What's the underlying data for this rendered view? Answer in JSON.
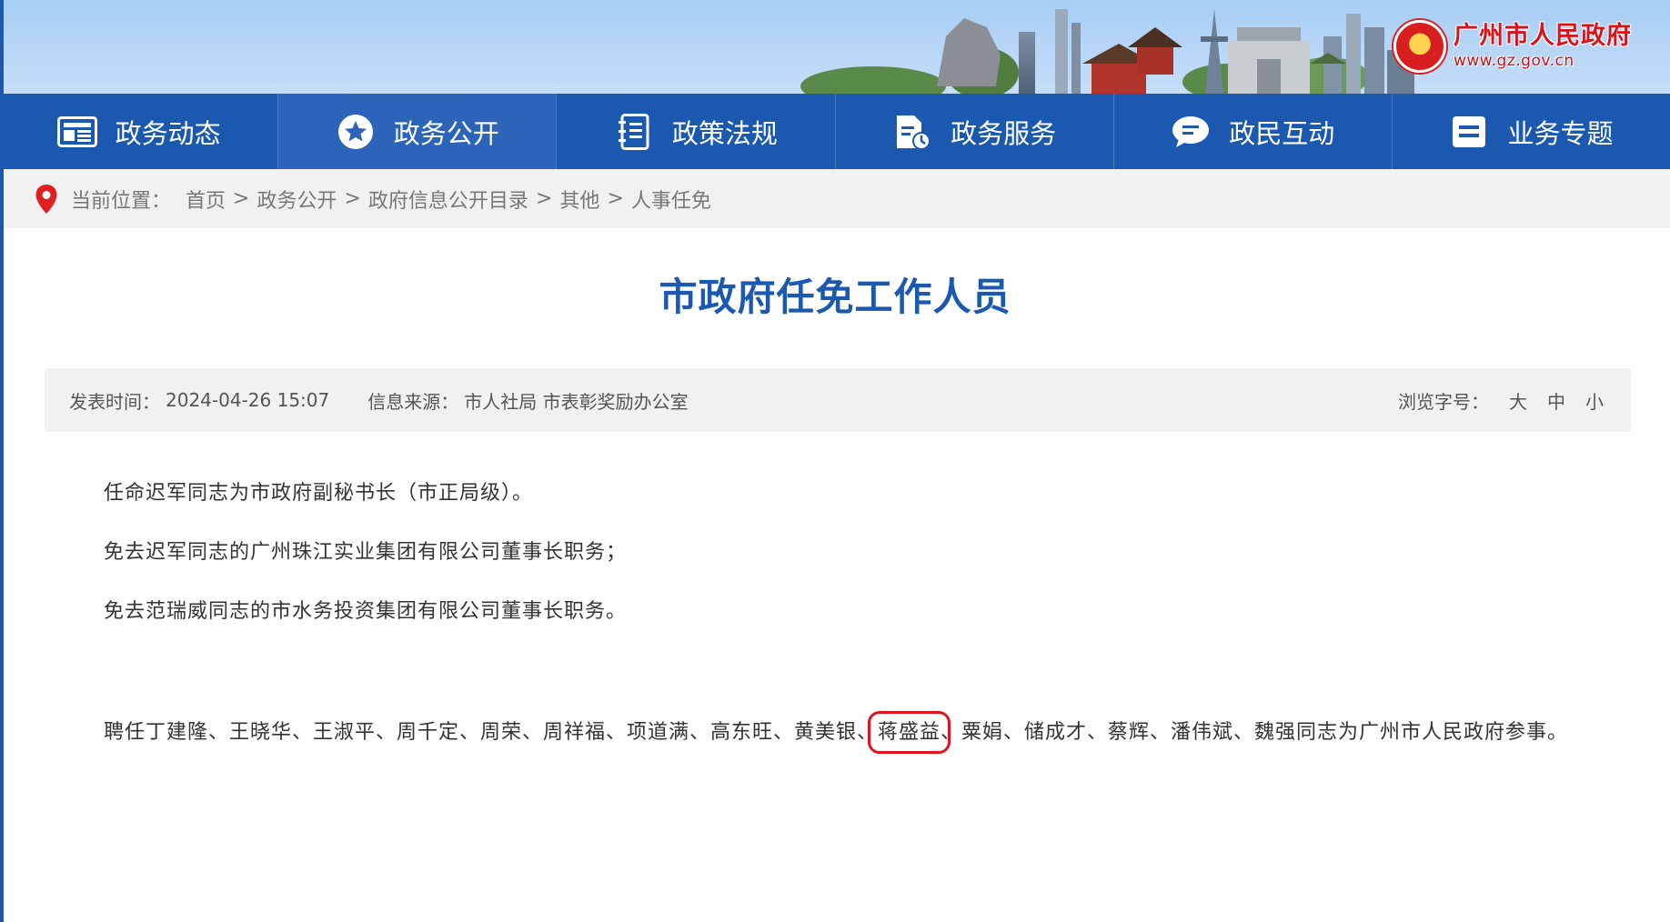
{
  "site": {
    "logo_title": "广州市人民政府",
    "logo_url": "www.gz.gov.cn"
  },
  "nav": {
    "items": [
      {
        "label": "政务动态",
        "icon": "newspaper-icon"
      },
      {
        "label": "政务公开",
        "icon": "star-badge-icon"
      },
      {
        "label": "政策法规",
        "icon": "notebook-icon"
      },
      {
        "label": "政务服务",
        "icon": "document-service-icon"
      },
      {
        "label": "政民互动",
        "icon": "chat-bubble-icon"
      },
      {
        "label": "业务专题",
        "icon": "list-icon"
      }
    ],
    "active_index": 1
  },
  "breadcrumb": {
    "label": "当前位置：",
    "items": [
      "首页",
      "政务公开",
      "政府信息公开目录",
      "其他",
      "人事任免"
    ],
    "separator": ">"
  },
  "article": {
    "title": "市政府任免工作人员",
    "meta": {
      "time_label": "发表时间：",
      "time_value": "2024-04-26 15:07",
      "source_label": "信息来源：",
      "source_value": "市人社局 市表彰奖励办公室",
      "fontsize_label": "浏览字号：",
      "fontsize_options": [
        "大",
        "中",
        "小"
      ]
    },
    "paragraphs": [
      "任命迟军同志为市政府副秘书长（市正局级）。",
      "免去迟军同志的广州珠江实业集团有限公司董事长职务；",
      "免去范瑞威同志的市水务投资集团有限公司董事长职务。"
    ],
    "appointment": {
      "before": "聘任丁建隆、王晓华、王淑平、周千定、周荣、周祥福、项道满、高东旺、黄美银、",
      "highlight": "蒋盛益",
      "after": "、粟娟、储成才、蔡辉、潘伟斌、魏强同志为广州市人民政府参事。"
    }
  },
  "colors": {
    "nav_bg": "#1b58b0",
    "title": "#1b58b0",
    "highlight_box": "#e0121b",
    "logo_red": "#d8141a"
  }
}
